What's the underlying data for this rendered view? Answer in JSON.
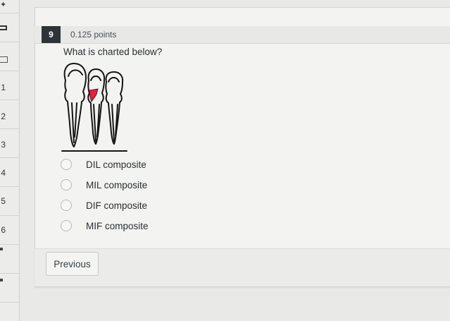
{
  "nav": {
    "numbers": [
      "1",
      "2",
      "3",
      "4",
      "5",
      "6"
    ]
  },
  "question": {
    "number": "9",
    "points": "0.125 points",
    "prompt": "What is charted below?"
  },
  "chart_image": {
    "shading_color": "#e0243a"
  },
  "options": [
    {
      "label": "DIL composite"
    },
    {
      "label": "MIL composite"
    },
    {
      "label": "DIF composite"
    },
    {
      "label": "MIF composite"
    }
  ],
  "footer": {
    "previous_label": "Previous"
  }
}
